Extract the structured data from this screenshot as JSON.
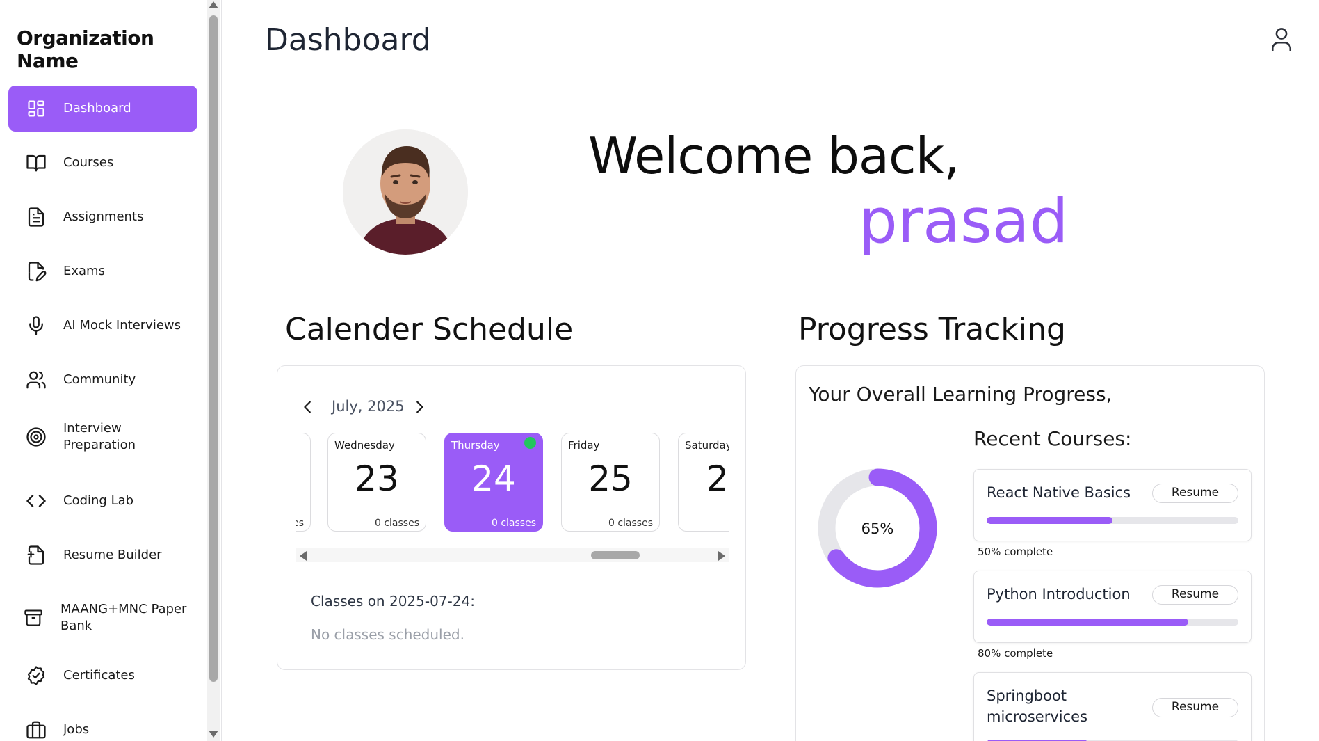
{
  "sidebar": {
    "org_name": "Organization Name",
    "items": [
      {
        "label": "Dashboard",
        "icon": "dashboard-grid-icon",
        "active": true
      },
      {
        "label": "Courses",
        "icon": "book-open-icon"
      },
      {
        "label": "Assignments",
        "icon": "file-text-icon"
      },
      {
        "label": "Exams",
        "icon": "file-edit-icon"
      },
      {
        "label": "AI Mock Interviews",
        "icon": "microphone-icon"
      },
      {
        "label": "Community",
        "icon": "users-icon"
      },
      {
        "label": "Interview Preparation",
        "icon": "target-icon"
      },
      {
        "label": "Coding Lab",
        "icon": "code-icon"
      },
      {
        "label": "Resume Builder",
        "icon": "file-plus-icon"
      },
      {
        "label": "MAANG+MNC Paper Bank",
        "icon": "archive-icon"
      },
      {
        "label": "Certificates",
        "icon": "badge-check-icon"
      },
      {
        "label": "Jobs",
        "icon": "briefcase-icon"
      }
    ]
  },
  "header": {
    "title": "Dashboard",
    "user_icon": "user-icon"
  },
  "welcome": {
    "greeting": "Welcome back,",
    "name": "prasad"
  },
  "calendar": {
    "section_title": "Calender Schedule",
    "month": "July, 2025",
    "days": [
      {
        "name": "",
        "num": "",
        "classes": "es",
        "partial": "left"
      },
      {
        "name": "Wednesday",
        "num": "23",
        "classes": "0 classes"
      },
      {
        "name": "Thursday",
        "num": "24",
        "classes": "0 classes",
        "selected": true,
        "has_dot": true
      },
      {
        "name": "Friday",
        "num": "25",
        "classes": "0 classes"
      },
      {
        "name": "Saturday",
        "num": "2",
        "classes": "",
        "partial": "right"
      }
    ],
    "classes_on": "Classes on 2025-07-24:",
    "no_classes": "No classes scheduled.",
    "scroll_position": 0.75
  },
  "progress": {
    "section_title": "Progress Tracking",
    "heading": "Your Overall Learning Progress,",
    "overall_percent": 65,
    "overall_label": "65%",
    "recent_title": "Recent Courses:",
    "courses": [
      {
        "name": "React Native Basics",
        "resume": "Resume",
        "percent": 50,
        "percent_label": "50% complete"
      },
      {
        "name": "Python Introduction",
        "resume": "Resume",
        "percent": 80,
        "percent_label": "80% complete"
      },
      {
        "name": "Springboot microservices",
        "resume": "Resume",
        "percent": 40,
        "percent_label": ""
      }
    ]
  },
  "colors": {
    "accent": "#9a5cf7",
    "dot": "#22c55e",
    "track": "#e6e6ea"
  }
}
